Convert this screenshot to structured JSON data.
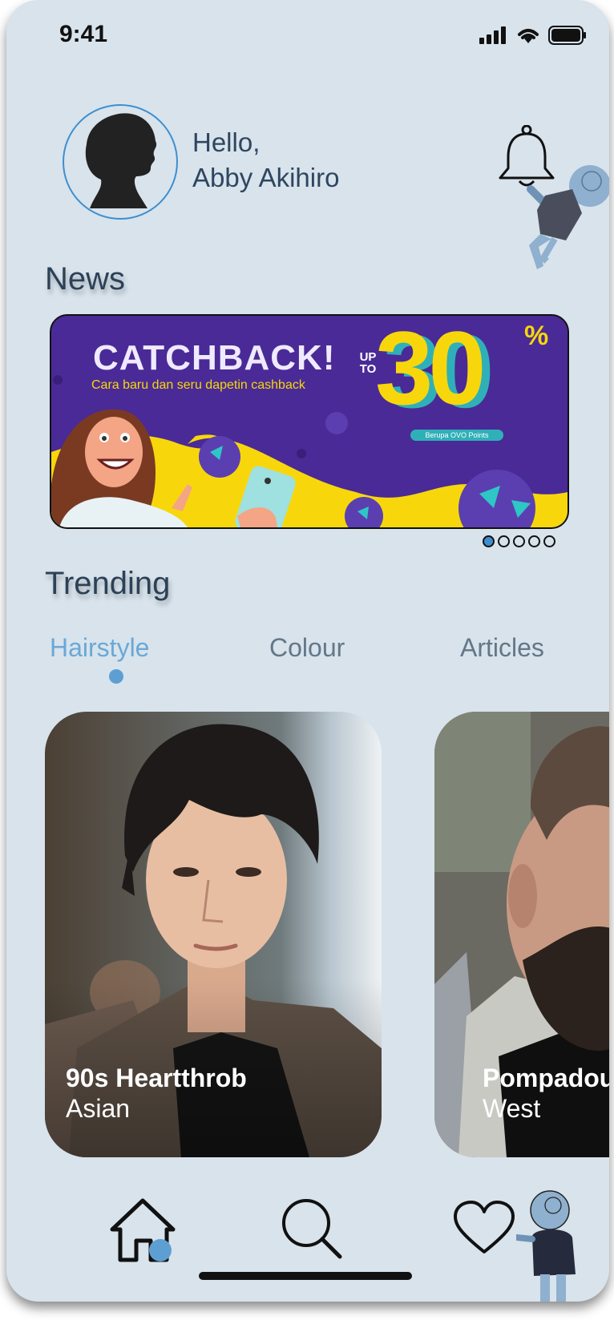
{
  "status": {
    "time": "9:41"
  },
  "header": {
    "greeting": "Hello,",
    "user_name": "Abby Akihiro"
  },
  "news": {
    "title": "News",
    "banner": {
      "headline": "CATCHBACK!",
      "subline": "Cara baru dan seru dapetin cashback",
      "up_to": "UP TO",
      "amount": "30",
      "percent": "%",
      "pill": "Berupa OVO Points"
    },
    "pages": 5,
    "active_page": 1
  },
  "trending": {
    "title": "Trending",
    "tabs": [
      {
        "label": "Hairstyle",
        "active": true
      },
      {
        "label": "Colour",
        "active": false
      },
      {
        "label": "Articles",
        "active": false
      }
    ],
    "cards": [
      {
        "title": "90s Heartthrob",
        "subtitle": "Asian"
      },
      {
        "title": "Pompadour",
        "subtitle": "West"
      }
    ]
  },
  "nav": {
    "items": [
      "home-icon",
      "search-icon",
      "heart-icon"
    ],
    "active": "home"
  },
  "colors": {
    "background": "#d8e3ec",
    "accent": "#3d8fd0",
    "banner_purple": "#4a2a96",
    "banner_yellow": "#f7d70c"
  }
}
